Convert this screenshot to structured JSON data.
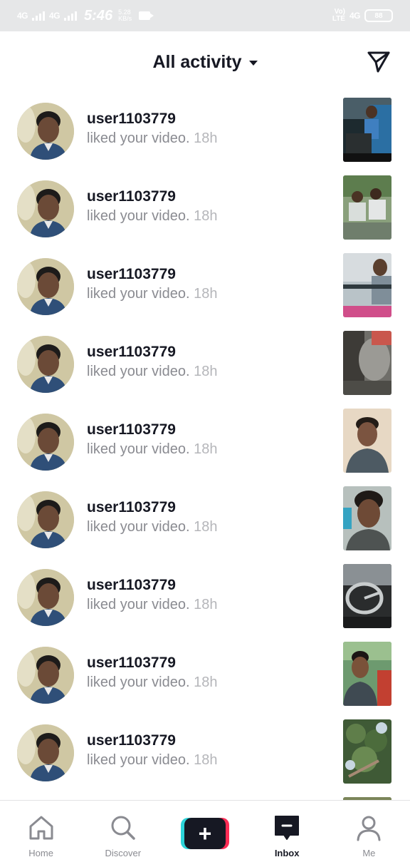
{
  "status_bar": {
    "network1": "4G",
    "network2": "4G",
    "time": "5:46",
    "speed_value": "5.28",
    "speed_unit": "KB/s",
    "volte_top": "Vo)",
    "volte_bottom": "LTE",
    "network3": "4G",
    "battery": "88"
  },
  "header": {
    "title": "All activity",
    "dropdown_icon": "caret-down-icon",
    "dm_icon": "paper-plane-icon"
  },
  "notifications": [
    {
      "username": "user1103779",
      "action": "liked your video.",
      "time": "18h"
    },
    {
      "username": "user1103779",
      "action": "liked your video.",
      "time": "18h"
    },
    {
      "username": "user1103779",
      "action": "liked your video.",
      "time": "18h"
    },
    {
      "username": "user1103779",
      "action": "liked your video.",
      "time": "18h"
    },
    {
      "username": "user1103779",
      "action": "liked your video.",
      "time": "18h"
    },
    {
      "username": "user1103779",
      "action": "liked your video.",
      "time": "18h"
    },
    {
      "username": "user1103779",
      "action": "liked your video.",
      "time": "18h"
    },
    {
      "username": "user1103779",
      "action": "liked your video.",
      "time": "18h"
    },
    {
      "username": "user1103779",
      "action": "liked your video.",
      "time": "18h"
    }
  ],
  "bottom_nav": {
    "home": "Home",
    "discover": "Discover",
    "create_symbol": "+",
    "inbox": "Inbox",
    "me": "Me"
  },
  "colors": {
    "text_primary": "#161823",
    "text_secondary": "#8a8b91",
    "accent_cyan": "#2cd4d9",
    "accent_red": "#fe2c55",
    "status_bar_bg": "#e6e7e8"
  }
}
